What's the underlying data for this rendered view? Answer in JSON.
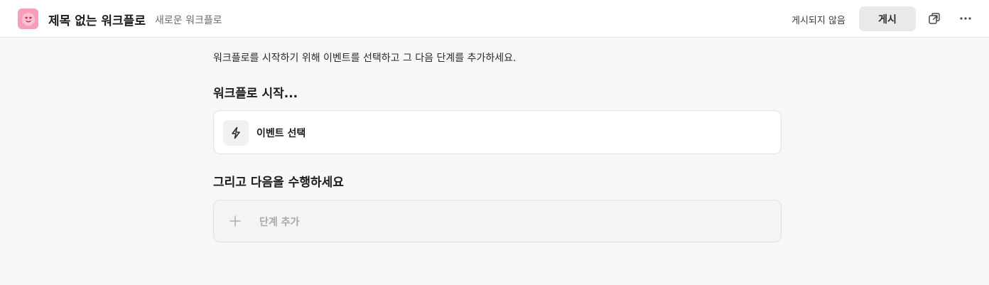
{
  "header": {
    "title": "제목 없는 워크플로",
    "subtitle": "새로운 워크플로",
    "status": "게시되지 않음",
    "publish_label": "게시",
    "app_icon": "heart-eyes-face-icon",
    "actions": [
      "open-in-new-window-icon",
      "more-horizontal-icon"
    ]
  },
  "main": {
    "intro": "워크플로를 시작하기 위해 이벤트를 선택하고 그 다음 단계를 추가하세요.",
    "start_heading": "워크플로 시작...",
    "event_button": {
      "label": "이벤트 선택",
      "icon": "lightning-bolt-icon"
    },
    "then_heading": "그리고 다음을 수행하세요",
    "add_step": {
      "label": "단계 추가",
      "icon": "plus-icon"
    }
  },
  "colors": {
    "app_icon_bg": "#f59fb8",
    "publish_bg": "#e9e9e9",
    "page_bg": "#f7f7f7"
  }
}
